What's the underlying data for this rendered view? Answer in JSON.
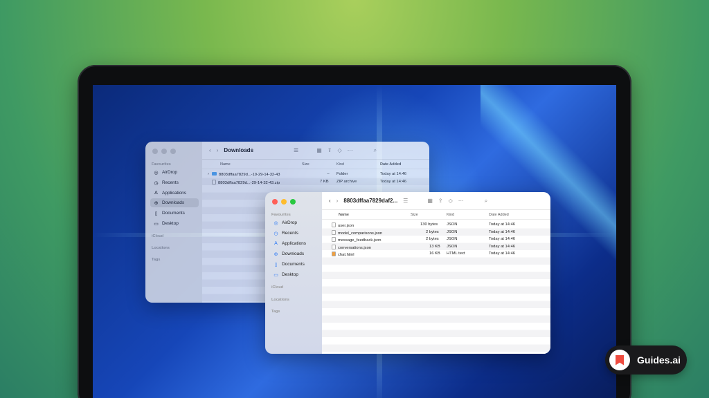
{
  "back_window": {
    "title": "Downloads",
    "sidebar": {
      "favourites_label": "Favourites",
      "items": [
        {
          "label": "AirDrop",
          "icon": "airdrop-icon"
        },
        {
          "label": "Recents",
          "icon": "clock-icon"
        },
        {
          "label": "Applications",
          "icon": "applications-icon"
        },
        {
          "label": "Downloads",
          "icon": "download-icon",
          "selected": true
        },
        {
          "label": "Documents",
          "icon": "document-icon"
        },
        {
          "label": "Desktop",
          "icon": "desktop-icon"
        }
      ],
      "icloud_label": "iCloud",
      "locations_label": "Locations",
      "tags_label": "Tags"
    },
    "columns": {
      "name": "Name",
      "size": "Size",
      "kind": "Kind",
      "date": "Date Added"
    },
    "rows": [
      {
        "name": "8803dffaa7829d...-10-29-14-32-43",
        "size": "--",
        "kind": "Folder",
        "date": "Today at 14:46"
      },
      {
        "name": "8803dffaa7829d...-29-14-32-43.zip",
        "size": "7 KB",
        "kind": "ZIP archive",
        "date": "Today at 14:46"
      }
    ]
  },
  "front_window": {
    "title": "8803dffaa7829daf2...",
    "sidebar": {
      "favourites_label": "Favourites",
      "items": [
        {
          "label": "AirDrop",
          "icon": "airdrop-icon"
        },
        {
          "label": "Recents",
          "icon": "clock-icon"
        },
        {
          "label": "Applications",
          "icon": "applications-icon"
        },
        {
          "label": "Downloads",
          "icon": "download-icon"
        },
        {
          "label": "Documents",
          "icon": "document-icon"
        },
        {
          "label": "Desktop",
          "icon": "desktop-icon"
        }
      ],
      "icloud_label": "iCloud",
      "locations_label": "Locations",
      "tags_label": "Tags"
    },
    "columns": {
      "name": "Name",
      "size": "Size",
      "kind": "Kind",
      "date": "Date Added"
    },
    "rows": [
      {
        "name": "user.json",
        "size": "130 bytes",
        "kind": "JSON",
        "date": "Today at 14:46"
      },
      {
        "name": "model_comparisons.json",
        "size": "2 bytes",
        "kind": "JSON",
        "date": "Today at 14:46"
      },
      {
        "name": "message_feedback.json",
        "size": "2 bytes",
        "kind": "JSON",
        "date": "Today at 14:46"
      },
      {
        "name": "conversations.json",
        "size": "13 KB",
        "kind": "JSON",
        "date": "Today at 14:46"
      },
      {
        "name": "chat.html",
        "size": "16 KB",
        "kind": "HTML text",
        "date": "Today at 14:46"
      }
    ]
  },
  "badge": {
    "text": "Guides.ai"
  },
  "colors": {
    "traffic_red": "#ff5f57",
    "traffic_yellow": "#febc2e",
    "traffic_green": "#28c840",
    "accent": "#2f7bf5"
  }
}
